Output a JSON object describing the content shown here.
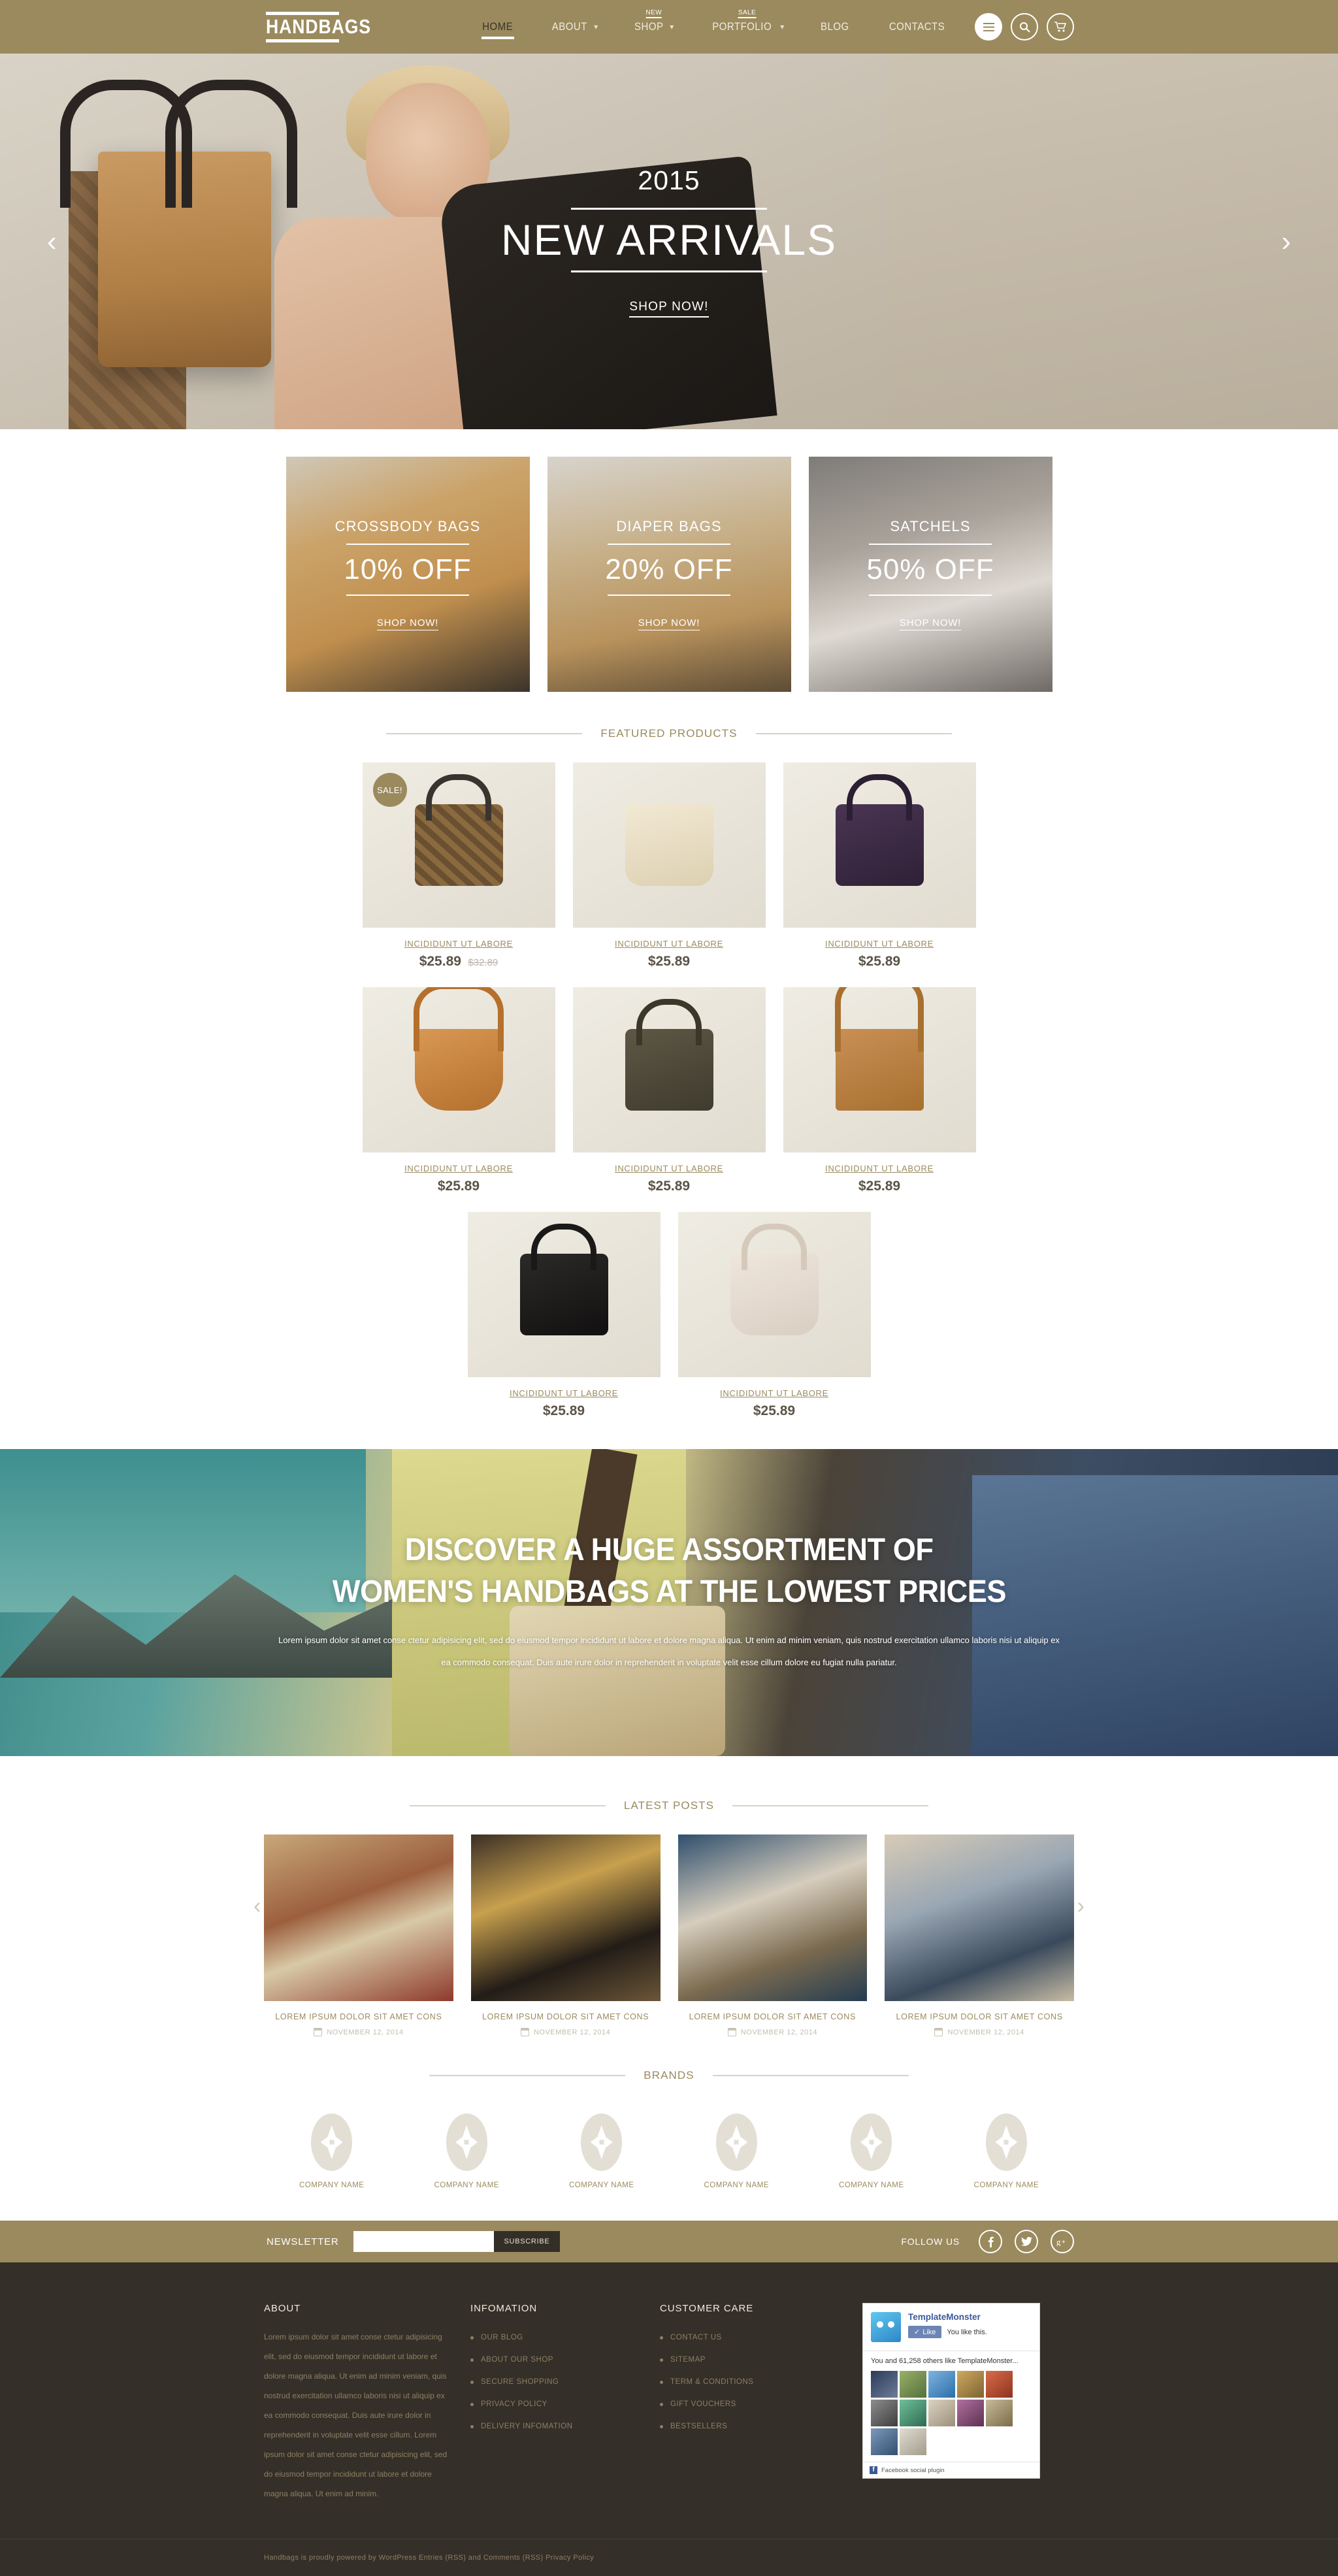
{
  "header": {
    "logo": "HANDBAGS",
    "nav": [
      {
        "label": "HOME",
        "active": true,
        "caret": false,
        "badge": ""
      },
      {
        "label": "ABOUT",
        "active": false,
        "caret": true,
        "badge": ""
      },
      {
        "label": "SHOP",
        "active": false,
        "caret": true,
        "badge": "NEW"
      },
      {
        "label": "PORTFOLIO",
        "active": false,
        "caret": true,
        "badge": "SALE"
      },
      {
        "label": "BLOG",
        "active": false,
        "caret": false,
        "badge": ""
      },
      {
        "label": "CONTACTS",
        "active": false,
        "caret": false,
        "badge": ""
      }
    ],
    "icons": [
      "menu-icon",
      "search-icon",
      "cart-icon"
    ],
    "accent_color": "#9a8a5e"
  },
  "hero": {
    "year": "2015",
    "title": "NEW ARRIVALS",
    "cta": "SHOP NOW!",
    "prev": "‹",
    "next": "›"
  },
  "promos": [
    {
      "category": "CROSSBODY BAGS",
      "discount": "10% OFF",
      "cta": "SHOP NOW!"
    },
    {
      "category": "DIAPER BAGS",
      "discount": "20% OFF",
      "cta": "SHOP NOW!"
    },
    {
      "category": "SATCHELS",
      "discount": "50% OFF",
      "cta": "SHOP NOW!"
    }
  ],
  "featured": {
    "heading": "FEATURED PRODUCTS",
    "products": [
      {
        "name": "INCIDIDUNT UT LABORE",
        "price": "$25.89",
        "old_price": "$32.89",
        "badge": "SALE!"
      },
      {
        "name": "INCIDIDUNT UT LABORE",
        "price": "$25.89",
        "old_price": "",
        "badge": ""
      },
      {
        "name": "INCIDIDUNT UT LABORE",
        "price": "$25.89",
        "old_price": "",
        "badge": ""
      },
      {
        "name": "INCIDIDUNT UT LABORE",
        "price": "$25.89",
        "old_price": "",
        "badge": ""
      },
      {
        "name": "INCIDIDUNT UT LABORE",
        "price": "$25.89",
        "old_price": "",
        "badge": ""
      },
      {
        "name": "INCIDIDUNT UT LABORE",
        "price": "$25.89",
        "old_price": "",
        "badge": ""
      },
      {
        "name": "INCIDIDUNT UT LABORE",
        "price": "$25.89",
        "old_price": "",
        "badge": ""
      },
      {
        "name": "INCIDIDUNT UT LABORE",
        "price": "$25.89",
        "old_price": "",
        "badge": ""
      }
    ]
  },
  "callout": {
    "line1": "DISCOVER A HUGE ASSORTMENT OF",
    "line2": "WOMEN'S HANDBAGS AT THE LOWEST PRICES",
    "paragraph": "Lorem ipsum dolor sit amet conse ctetur adipisicing elit, sed do eiusmod tempor incididunt ut labore et dolore magna aliqua. Ut enim ad minim veniam, quis nostrud exercitation ullamco laboris nisi ut aliquip ex ea commodo consequat. Duis aute irure dolor in reprehenderit in voluptate velit esse cillum dolore eu fugiat nulla pariatur."
  },
  "posts": {
    "heading": "LATEST POSTS",
    "prev": "‹",
    "next": "›",
    "items": [
      {
        "title": "LOREM IPSUM DOLOR SIT AMET CONS",
        "date": "NOVEMBER 12, 2014"
      },
      {
        "title": "LOREM IPSUM DOLOR SIT AMET CONS",
        "date": "NOVEMBER 12, 2014"
      },
      {
        "title": "LOREM IPSUM DOLOR SIT AMET CONS",
        "date": "NOVEMBER 12, 2014"
      },
      {
        "title": "LOREM IPSUM DOLOR SIT AMET CONS",
        "date": "NOVEMBER 12, 2014"
      }
    ]
  },
  "brands": {
    "heading": "BRANDS",
    "items": [
      {
        "name": "COMPANY NAME"
      },
      {
        "name": "COMPANY NAME"
      },
      {
        "name": "COMPANY NAME"
      },
      {
        "name": "COMPANY NAME"
      },
      {
        "name": "COMPANY NAME"
      },
      {
        "name": "COMPANY NAME"
      }
    ]
  },
  "newsletter": {
    "label": "NEWSLETTER",
    "input_value": "",
    "placeholder": "",
    "button": "SUBSCRIBE",
    "follow_label": "FOLLOW US",
    "social": [
      {
        "name": "facebook-icon",
        "glyph": "f"
      },
      {
        "name": "twitter-icon",
        "glyph": "✉"
      },
      {
        "name": "googleplus-icon",
        "glyph": "g+"
      }
    ]
  },
  "footer": {
    "about": {
      "title": "ABOUT",
      "text": "Lorem ipsum dolor sit amet conse ctetur adipisicing elit, sed do eiusmod tempor incididunt ut labore et dolore magna aliqua. Ut enim ad minim veniam, quis nostrud exercitation ullamco laboris nisi ut aliquip ex ea commodo consequat. Duis aute irure dolor in reprehenderit in voluptate velit esse cillum. Lorem ipsum dolor sit amet conse ctetur adipisicing elit, sed do eiusmod tempor incididunt ut labore et dolore magna aliqua. Ut enim ad minim."
    },
    "information": {
      "title": "INFOMATION",
      "links": [
        "OUR BLOG",
        "ABOUT OUR SHOP",
        "SECURE SHOPPING",
        "PRIVACY POLICY",
        "DELIVERY INFOMATION"
      ]
    },
    "customer_care": {
      "title": "CUSTOMER CARE",
      "links": [
        "CONTACT US",
        "SITEMAP",
        "TERM & CONDITIONS",
        "GIFT VOUCHERS",
        "BESTSELLERS"
      ]
    },
    "facebook_widget": {
      "page_name": "TemplateMonster",
      "like_button": "Like",
      "like_status": "You like this.",
      "social_proof": "You and 61,258 others like TemplateMonster...",
      "plugin_label": "Facebook social plugin"
    },
    "copyright": "Handbags is proudly powered by WordPress Entries (RSS) and Comments (RSS) Privacy Policy"
  }
}
